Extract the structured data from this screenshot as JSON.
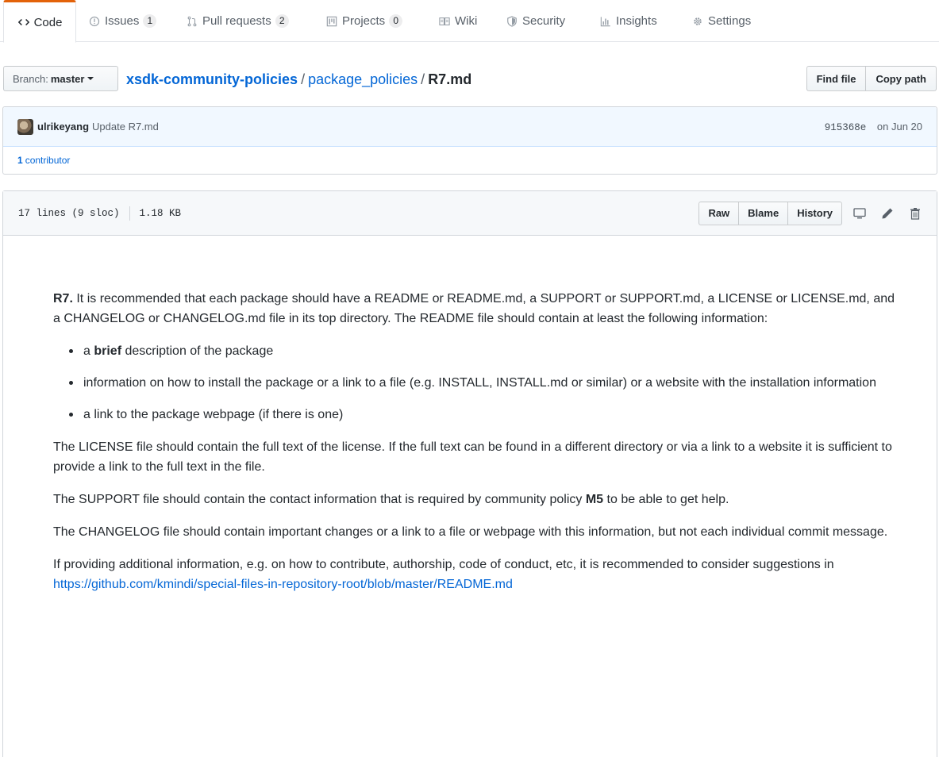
{
  "nav": {
    "tabs": [
      {
        "label": "Code",
        "icon": "code-icon"
      },
      {
        "label": "Issues",
        "icon": "issue-icon",
        "count": "1"
      },
      {
        "label": "Pull requests",
        "icon": "pull-request-icon",
        "count": "2"
      },
      {
        "label": "Projects",
        "icon": "project-icon",
        "count": "0"
      },
      {
        "label": "Wiki",
        "icon": "book-icon"
      },
      {
        "label": "Security",
        "icon": "shield-icon"
      },
      {
        "label": "Insights",
        "icon": "graph-icon"
      },
      {
        "label": "Settings",
        "icon": "gear-icon"
      }
    ],
    "selected_color": "#e36209"
  },
  "branch": {
    "prefix": "Branch:",
    "name": "master"
  },
  "breadcrumb": {
    "repo": "xsdk-community-policies",
    "sep1": "/",
    "dir": "package_policies",
    "sep2": "/",
    "file": "R7.md"
  },
  "file_nav": {
    "find_file": "Find file",
    "copy_path": "Copy path"
  },
  "commit": {
    "author": "ulrikeyang",
    "message": "Update R7.md",
    "sha": "915368e",
    "date": "on Jun 20",
    "contributors_count": "1",
    "contributors_label": "contributor"
  },
  "file": {
    "lines": "17 lines (9 sloc)",
    "size": "1.18 KB",
    "actions": {
      "raw": "Raw",
      "blame": "Blame",
      "history": "History"
    },
    "icons": [
      "desktop-icon",
      "pencil-icon",
      "trashcan-icon"
    ]
  },
  "content": {
    "p1_bold": "R7.",
    "p1_text": " It is recommended that each package should have a README or README.md, a SUPPORT or SUPPORT.md, a LICENSE or LICENSE.md, and a CHANGELOG or CHANGELOG.md file in its top directory. The README file should contain at least the following information:",
    "li1_pre": "a ",
    "li1_bold": "brief",
    "li1_post": " description of the package",
    "li2": "information on how to install the package or a link to a file (e.g. INSTALL, INSTALL.md or similar) or a website with the installation information",
    "li3": "a link to the package webpage (if there is one)",
    "p2": "The LICENSE file should contain the full text of the license. If the full text can be found in a different directory or via a link to a website it is sufficient to provide a link to the full text in the file.",
    "p3_pre": "The SUPPORT file should contain the contact information that is required by community policy ",
    "p3_bold": "M5",
    "p3_post": " to be able to get help.",
    "p4": "The CHANGELOG file should contain important changes or a link to a file or webpage with this information, but not each individual commit message.",
    "p5_pre": "If providing additional information, e.g. on how to contribute, authorship, code of conduct, etc, it is recommended to consider suggestions in ",
    "p5_link": "https://github.com/kmindi/special-files-in-repository-root/blob/master/README.md"
  }
}
